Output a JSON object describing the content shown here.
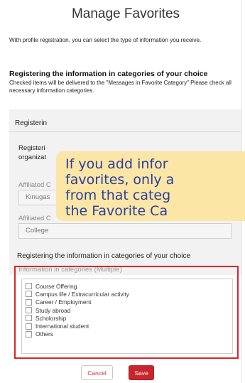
{
  "title": "Manage Favorites",
  "intro": "With profile registration, you can select the type of information you receive.",
  "section": {
    "heading": "Registering the information in categories of your choice",
    "description": "Checked items will be delivered to the \"Messages in Favorite Category\" Please check all necessary information categories."
  },
  "panel": {
    "heading": "Registerin",
    "subheading": "Registeri organizat",
    "fields": [
      {
        "label": "Affiliated C",
        "value": "Kinugas"
      },
      {
        "label": "Affiliated C",
        "value": "College"
      }
    ]
  },
  "categories": {
    "heading": "Registering the information in categories of your choice",
    "subheading": "Information in categories (Multiple)",
    "options": [
      "Course Offering",
      "Campus life / Extracurricular activity",
      "Career / Employment",
      "Study abroad",
      "Scholorship",
      "International student",
      "Others"
    ]
  },
  "buttons": {
    "cancel": "Cancel",
    "save": "Save"
  },
  "tooltip": {
    "lines": [
      "If you add infor",
      "favorites, only a",
      "from that categ",
      "the Favorite Ca"
    ]
  },
  "colors": {
    "accent_red": "#c8252c",
    "highlight_border": "#d9252b",
    "tooltip_bg": "#fbe6a6",
    "tooltip_text": "#2a3f9e"
  }
}
